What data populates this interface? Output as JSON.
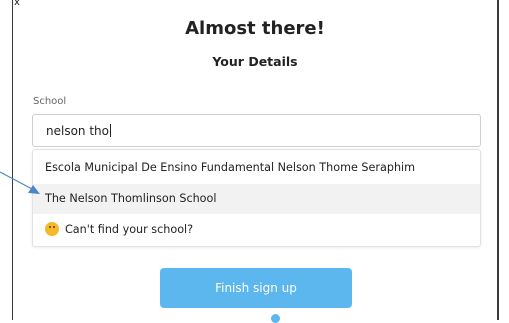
{
  "close_label": "x",
  "title": "Almost there!",
  "subtitle": "Your Details",
  "school_field": {
    "label": "School",
    "value": "nelson tho"
  },
  "suggestions": [
    {
      "label": "Escola Municipal De Ensino Fundamental Nelson Thome Seraphim"
    },
    {
      "label": "The Nelson Thomlinson School"
    },
    {
      "label": "Can't find your school?",
      "icon": "thinking-face-emoji"
    }
  ],
  "finish_button": "Finish sign up",
  "colors": {
    "accent": "#5bb7ee",
    "arrow": "#4a86c8",
    "hover_row": "#f2f2f2"
  }
}
